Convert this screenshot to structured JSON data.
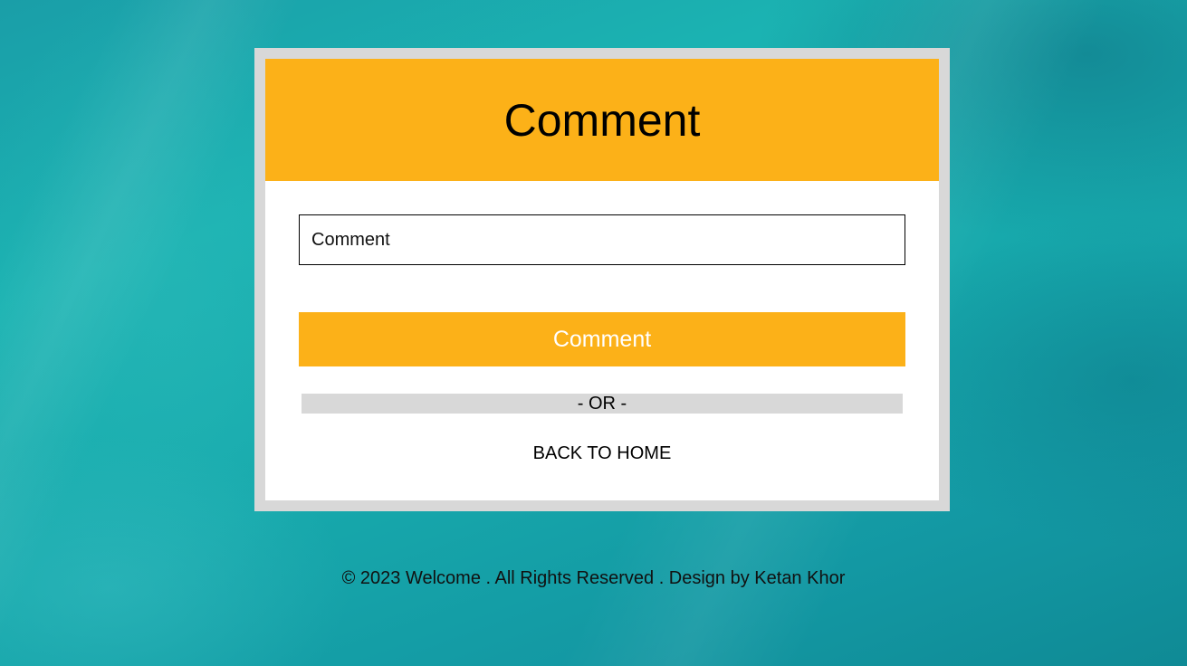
{
  "card": {
    "title": "Comment",
    "input_placeholder": "Comment",
    "submit_label": "Comment",
    "divider_label": "- OR -",
    "back_label": "BACK TO HOME"
  },
  "footer": {
    "text": "© 2023 Welcome . All Rights Reserved . Design by Ketan Khor"
  },
  "colors": {
    "accent": "#fcb118",
    "card_border": "#d8d8d8",
    "background": "#1bb3b2"
  }
}
